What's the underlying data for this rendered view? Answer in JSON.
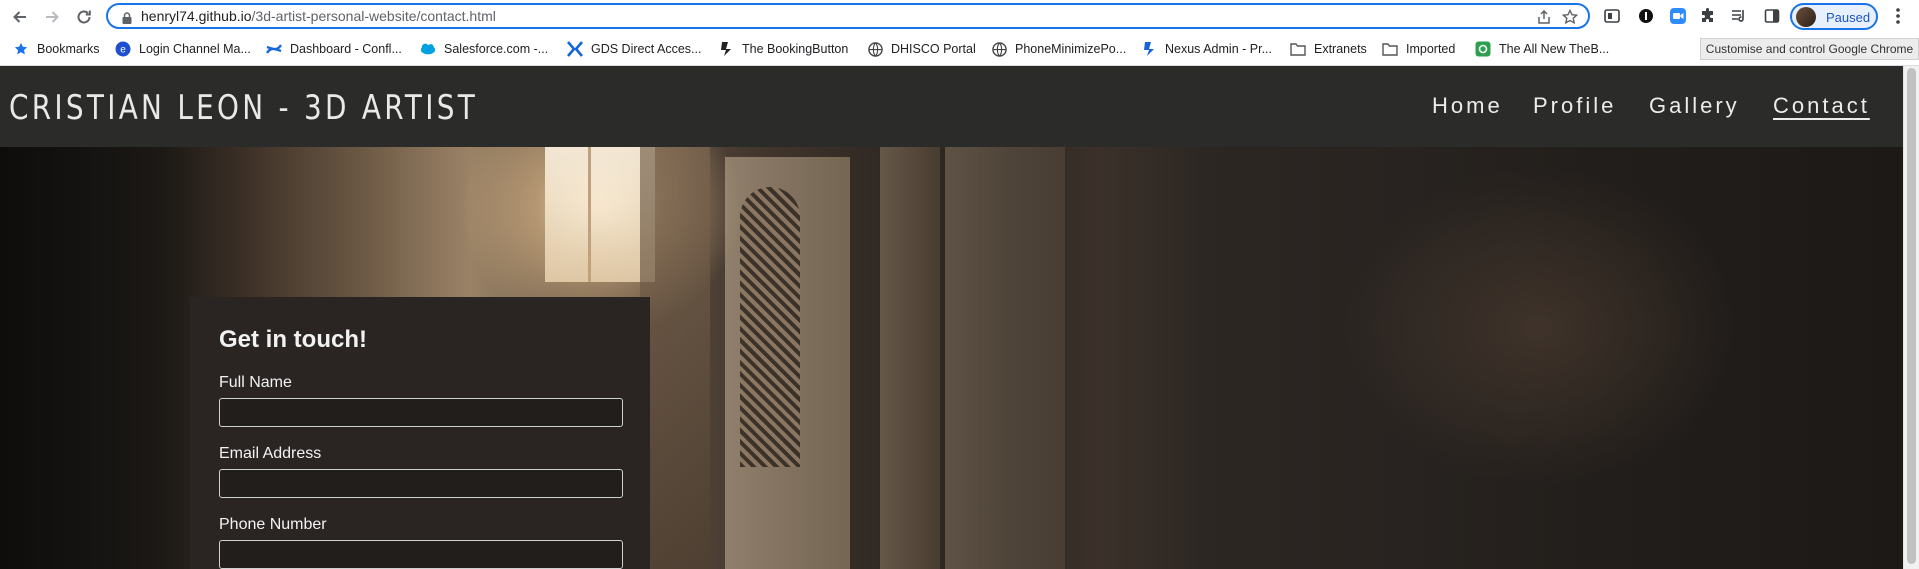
{
  "browser": {
    "url_host": "henryl74.github.io",
    "url_path": "/3d-artist-personal-website/contact.html",
    "profile_label": "Paused",
    "tooltip": "Customise and control Google Chrome",
    "bookmarks": [
      {
        "label": "Bookmarks",
        "icon": "star-icon"
      },
      {
        "label": "Login Channel Ma...",
        "icon": "globe-icon"
      },
      {
        "label": "Dashboard - Confl...",
        "icon": "confluence-icon"
      },
      {
        "label": "Salesforce.com -...",
        "icon": "salesforce-icon"
      },
      {
        "label": "GDS Direct Acces...",
        "icon": "gds-icon"
      },
      {
        "label": "The BookingButton",
        "icon": "bookingbutton-icon"
      },
      {
        "label": "DHISCO Portal",
        "icon": "globe-icon"
      },
      {
        "label": "PhoneMinimizePo...",
        "icon": "globe-icon"
      },
      {
        "label": "Nexus Admin - Pr...",
        "icon": "nexus-icon"
      },
      {
        "label": "Extranets",
        "icon": "folder-icon"
      },
      {
        "label": "Imported",
        "icon": "folder-icon"
      },
      {
        "label": "The All New TheB...",
        "icon": "theb-icon"
      }
    ]
  },
  "site": {
    "title": "CRISTIAN LEON - 3D ARTIST",
    "nav": [
      {
        "label": "Home"
      },
      {
        "label": "Profile"
      },
      {
        "label": "Gallery"
      },
      {
        "label": "Contact",
        "active": true
      }
    ]
  },
  "contact": {
    "heading": "Get in touch!",
    "fields": [
      {
        "label": "Full Name",
        "value": ""
      },
      {
        "label": "Email Address",
        "value": ""
      },
      {
        "label": "Phone Number",
        "value": ""
      }
    ]
  },
  "colors": {
    "accent": "#1a73e8",
    "header_bg": "#2b2b29",
    "card_bg": "#2a2523"
  }
}
